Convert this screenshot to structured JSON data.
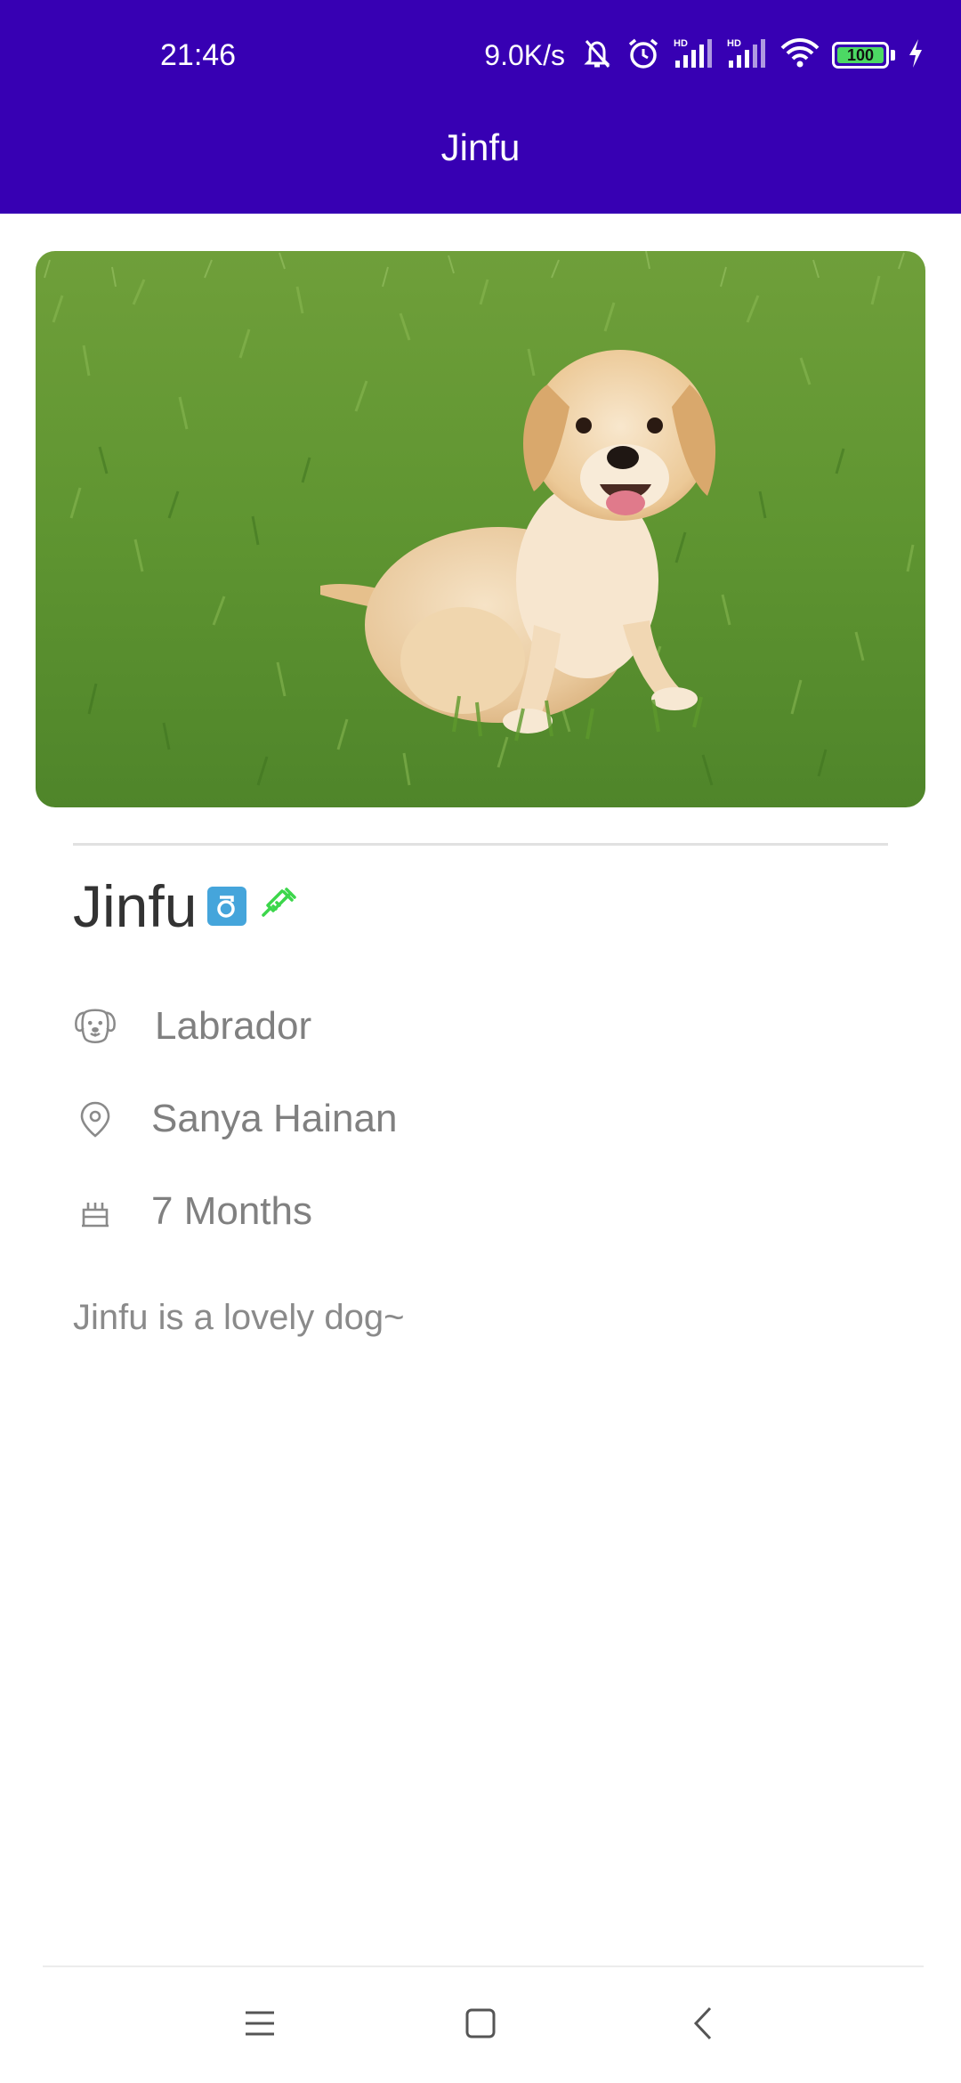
{
  "status_bar": {
    "time": "21:46",
    "network_speed": "9.0K/s",
    "battery": "100",
    "icons": [
      "mute-bell-icon",
      "alarm-icon",
      "signal-hd-icon",
      "signal-hd-icon",
      "wifi-icon",
      "battery-icon",
      "charging-icon"
    ]
  },
  "app_bar": {
    "title": "Jinfu",
    "color": "#3700B3"
  },
  "pet": {
    "name": "Jinfu",
    "gender_icon": "male-gender-icon",
    "vaccinated_icon": "syringe-icon",
    "breed": "Labrador",
    "location": "Sanya Hainan",
    "age": "7 Months",
    "description": "Jinfu is a lovely dog~"
  },
  "nav_bar": {
    "icons": [
      "menu-icon",
      "home-square-icon",
      "back-chevron-icon"
    ]
  }
}
